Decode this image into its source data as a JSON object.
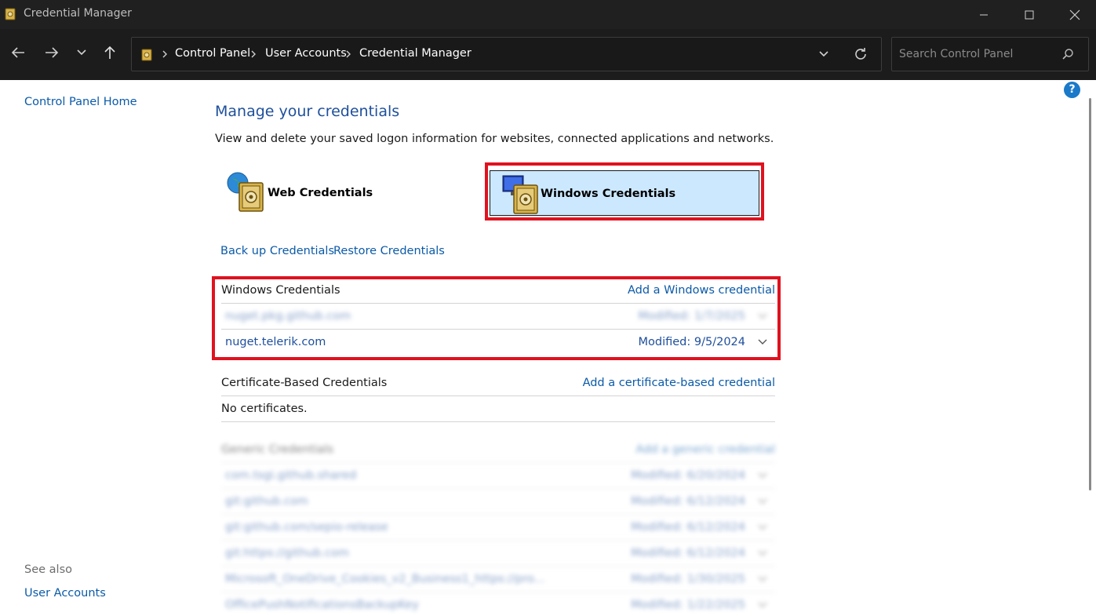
{
  "window": {
    "title": "Credential Manager"
  },
  "address": {
    "crumbs": [
      "Control Panel",
      "User Accounts",
      "Credential Manager"
    ],
    "search_placeholder": "Search Control Panel"
  },
  "sidebar": {
    "home": "Control Panel Home",
    "see_also": "See also",
    "user_accounts": "User Accounts"
  },
  "main": {
    "heading": "Manage your credentials",
    "description": "View and delete your saved logon information for websites, connected applications and networks.",
    "tiles": {
      "web": "Web Credentials",
      "windows": "Windows Credentials"
    },
    "backup": "Back up Credentials",
    "restore": "Restore Credentials"
  },
  "windows_section": {
    "title": "Windows Credentials",
    "add": "Add a Windows credential",
    "rows": [
      {
        "name": "nuget.pkg.github.com",
        "modified": "Modified:  1/7/2025"
      },
      {
        "name": "nuget.telerik.com",
        "modified": "Modified:  9/5/2024"
      }
    ]
  },
  "cert_section": {
    "title": "Certificate-Based Credentials",
    "add": "Add a certificate-based credential",
    "empty": "No certificates."
  },
  "generic_section": {
    "title": "Generic Credentials",
    "add": "Add a generic credential",
    "rows": [
      {
        "name": "com.tsgi.github.shared",
        "modified": "Modified:  6/20/2024"
      },
      {
        "name": "git:github.com",
        "modified": "Modified:  6/12/2024"
      },
      {
        "name": "git:github.com/sepio-release",
        "modified": "Modified:  6/12/2024"
      },
      {
        "name": "git:https://github.com",
        "modified": "Modified:  6/12/2024"
      },
      {
        "name": "Microsoft_OneDrive_Cookies_v2_Business1_https://pro...",
        "modified": "Modified:  1/30/2025"
      },
      {
        "name": "OfficePushNotificationsBackupKey",
        "modified": "Modified:  1/22/2025"
      }
    ]
  },
  "colors": {
    "link": "#0b5aa8",
    "heading": "#1e4f9c",
    "highlight": "#e0121f",
    "selected_tile": "#cce8ff"
  }
}
